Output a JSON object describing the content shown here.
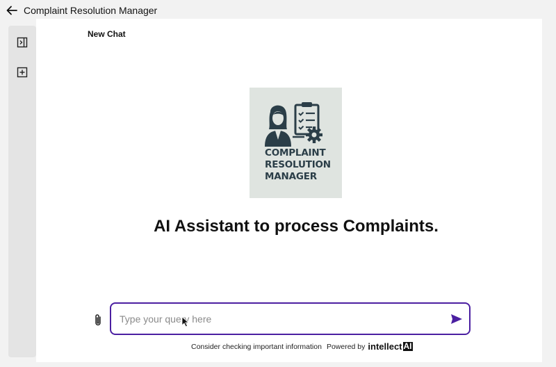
{
  "header": {
    "title": "Complaint Resolution Manager",
    "back_icon": "arrow-left-icon"
  },
  "sidebar": {
    "toggle_icon": "sidebar-toggle-icon",
    "new_chat_icon": "add-square-icon"
  },
  "chat": {
    "title": "New Chat",
    "logo_lines": [
      "COMPLAINT",
      "RESOLUTION",
      "MANAGER"
    ],
    "headline": "AI Assistant to process Complaints."
  },
  "composer": {
    "placeholder": "Type your query here",
    "value": "",
    "attach_icon": "paperclip-icon",
    "send_icon": "send-icon"
  },
  "footer": {
    "notice": "Consider checking important information",
    "powered_by": "Powered by",
    "brand_main": "intellect",
    "brand_ai": "AI"
  },
  "colors": {
    "accent": "#4b1fa1",
    "logo_bg": "#dfe4e0",
    "logo_ink": "#2b3e48"
  }
}
